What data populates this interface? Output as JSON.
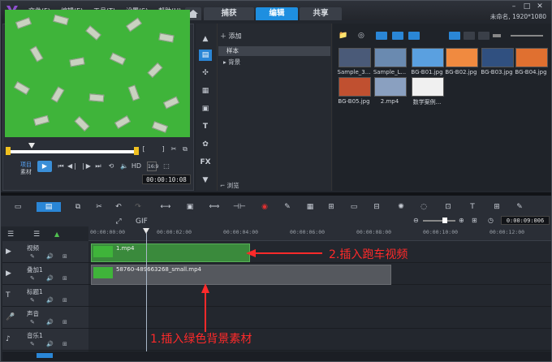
{
  "app": {
    "menus": [
      "文件(F)",
      "编辑(E)",
      "工具(T)",
      "设置(S)",
      "帮助(H)"
    ],
    "tabs": [
      {
        "label": "捕获",
        "active": false
      },
      {
        "label": "编辑",
        "active": true
      },
      {
        "label": "共享",
        "active": false
      }
    ],
    "project_info": "未命名, 1920*1080",
    "accent_color": "#1e8fe0"
  },
  "preview": {
    "mode_project": "项目",
    "mode_clip": "素材",
    "hd_label": "HD",
    "timecode": "00:00:10:08",
    "bracket_left": "[",
    "bracket_right": "]"
  },
  "library": {
    "add_label": "添加",
    "sample_label": "样本",
    "bg_folder_label": "背景",
    "browse_label": "浏览",
    "items": [
      {
        "label": "Sample_3...",
        "icon": "video-thumb"
      },
      {
        "label": "Sample_L...",
        "icon": "video-thumb"
      },
      {
        "label": "BG-B01.jpg",
        "icon": "image-thumb"
      },
      {
        "label": "BG-B02.jpg",
        "icon": "image-thumb"
      },
      {
        "label": "BG-B03.jpg",
        "icon": "image-thumb"
      },
      {
        "label": "BG-B04.jpg",
        "icon": "image-thumb"
      },
      {
        "label": "BG-B05.jpg",
        "icon": "image-thumb"
      },
      {
        "label": "2.mp4",
        "icon": "video-thumb"
      },
      {
        "label": "数学案例...",
        "icon": "image-thumb"
      }
    ]
  },
  "timeline": {
    "ruler_ticks": [
      "00:00:00:00",
      "00:00:02:00",
      "00:00:04:00",
      "00:00:06:00",
      "00:00:08:00",
      "00:00:10:00",
      "00:00:12:00"
    ],
    "zoom_timecode": "0:00:09:006",
    "tracks": [
      {
        "label": "视频",
        "icon": "video-track-icon"
      },
      {
        "label": "叠加1",
        "icon": "overlay-track-icon"
      },
      {
        "label": "标题1",
        "icon": "title-track-icon"
      },
      {
        "label": "声音",
        "icon": "voice-track-icon"
      },
      {
        "label": "音乐1",
        "icon": "music-track-icon"
      }
    ],
    "clips": [
      {
        "track": "视频",
        "label": "1.mp4"
      },
      {
        "track": "叠加1",
        "label": "58760-489663268_small.mp4"
      }
    ]
  },
  "annotations": {
    "step2": "2.插入跑车视频",
    "step1": "1.插入绿色背景素材",
    "color": "#ff2a2a"
  }
}
